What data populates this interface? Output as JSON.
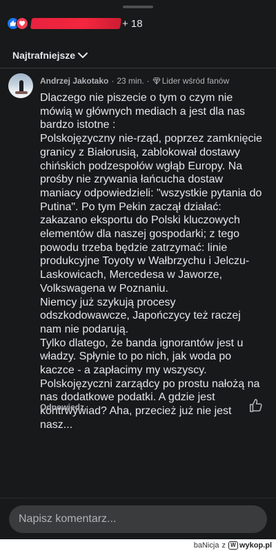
{
  "reactions": {
    "icons": [
      "like-icon",
      "love-icon",
      "wow-icon"
    ],
    "count_label": "+ 18"
  },
  "sort": {
    "label": "Najtrafniejsze"
  },
  "comment": {
    "author": "Andrzej Jakotako",
    "time": "23 min.",
    "badge": "Lider wśród fanów",
    "text": "Dlaczego nie piszecie o tym o czym nie mówią w głównych mediach a jest dla nas bardzo istotne :\nPolskojęzyczny nie-rząd, poprzez zamknięcie granicy z Białorusią, zablokował dostawy chińskich podzespołów wgłąb Europy. Na prośby nie zrywania łańcucha dostaw maniacy odpowiedzieli: \"wszystkie pytania do Putina\". Po tym Pekin zaczął działać: zakazano eksportu do Polski kluczowych elementów dla naszej gospodarki; z tego powodu trzeba będzie zatrzymać: linie produkcyjne Toyoty w Wałbrzychu i Jelczu-Laskowicach, Mercedesa w Jaworze, Volkswagena w Poznaniu.\nNiemcy już szykują procesy odszkodowawcze, Japończycy też raczej nam nie podarują.\nTylko dlatego, że banda ignorantów jest u władzy. Spłynie to po nich, jak woda po kaczce - a zapłacimy my wszyscy. Polskojęzyczni zarządcy po prostu nałożą na nas dodatkowe podatki. A gdzie jest kontrwywiad? Aha, przecież już nie jest nasz...",
    "reply_label": "Odpowiedz"
  },
  "composer": {
    "placeholder": "Napisz komentarz..."
  },
  "watermark": {
    "user": "baNicja",
    "connector": "z",
    "site": "wykop.pl"
  },
  "colors": {
    "background": "#18191a",
    "like_blue": "#1877f2",
    "love_red": "#f33e58",
    "input_bg": "#3a3b3c"
  }
}
